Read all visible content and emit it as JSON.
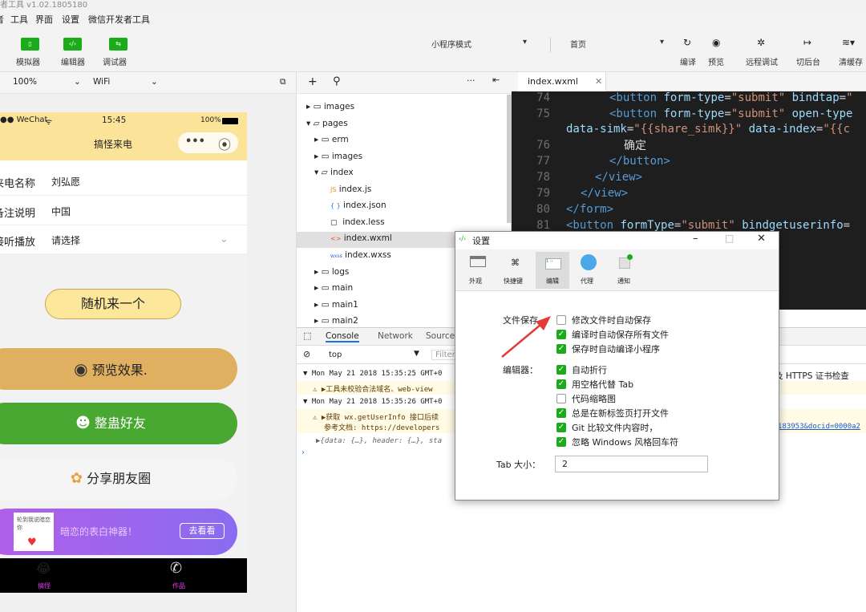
{
  "window": {
    "title": "者工具 v1.02.1805180"
  },
  "menu": [
    "者",
    "工具",
    "界面",
    "设置",
    "微信开发者工具"
  ],
  "toolbar": {
    "sim_label": "模拟器",
    "editor_label": "编辑器",
    "debug_label": "调试器",
    "mode": "小程序模式",
    "page": "首页",
    "compile": "编译",
    "preview": "预览",
    "remote": "远程调试",
    "background": "切后台",
    "cache": "清缓存",
    "colors": {
      "accent": "#1aad19"
    }
  },
  "simbar": {
    "zoom": "100%",
    "network": "WiFi"
  },
  "phone": {
    "carrier": "●● WeChat",
    "time": "15:45",
    "battery": "100%",
    "nav_title": "搞怪来电",
    "rows": [
      {
        "label": "来电名称",
        "value": "刘弘愿"
      },
      {
        "label": "备注说明",
        "value": "中国"
      },
      {
        "label": "接听播放",
        "value": "请选择"
      }
    ],
    "random_button": "随机来一个",
    "preview_button": "预览效果.",
    "prank_button": "整蛊好友",
    "share_button": "分享朋友圈",
    "banner_text": "暗恋的表白神器！",
    "banner_button": "去看看",
    "banner_img_text": "轮到我说暗恋你",
    "tab1": "搞怪",
    "tab2": "作品"
  },
  "filetree": {
    "items": [
      "images",
      "pages",
      "erm",
      "images",
      "index",
      "index.js",
      "index.json",
      "index.less",
      "index.wxml",
      "index.wxss",
      "logs",
      "main",
      "main1",
      "main2"
    ]
  },
  "editor": {
    "tab": "index.wxml",
    "lines": [
      {
        "n": "74",
        "code": "<button form-type=\"submit\" bindtap=\""
      },
      {
        "n": "75",
        "code": "<button form-type=\"submit\" open-type"
      },
      {
        "n": "",
        "code": "data-simk=\"{{share_simk}}\" data-index=\"{{c"
      },
      {
        "n": "76",
        "code": "确定"
      },
      {
        "n": "77",
        "code": "</button>"
      },
      {
        "n": "78",
        "code": "</view>"
      },
      {
        "n": "79",
        "code": "</view>"
      },
      {
        "n": "80",
        "code": "</form>"
      },
      {
        "n": "81",
        "code": "<button formType=\"submit\" bindgetuserinfo="
      }
    ]
  },
  "console": {
    "tabs": [
      "Console",
      "Network",
      "Sources"
    ],
    "context": "top",
    "filter": "Filter",
    "lines": [
      "▼ Mon May 21 2018 15:35:25 GMT+0",
      "⚠ ▶工具未校验合法域名、web-view",
      "▼ Mon May 21 2018 15:35:26 GMT+0",
      "⚠ ▶获取 wx.getUserInfo 接口后续",
      "参考文档: https://developers",
      "▶{data: {…}, header: {…}, sta"
    ],
    "https_check": "及 HTTPS 证书检查",
    "url_tail": "183953&docid=0000a2"
  },
  "dialog": {
    "title": "设置",
    "tabs": [
      "外观",
      "快捷键",
      "编辑",
      "代理",
      "通知"
    ],
    "file_save_label": "文件保存",
    "file_save": [
      {
        "text": "修改文件时自动保存",
        "checked": false
      },
      {
        "text": "编译时自动保存所有文件",
        "checked": true
      },
      {
        "text": "保存时自动编译小程序",
        "checked": true
      }
    ],
    "editor_label": "编辑器：",
    "editor_opts": [
      {
        "text": "自动折行",
        "checked": true
      },
      {
        "text": "用空格代替 Tab",
        "checked": true
      },
      {
        "text": "代码缩略图",
        "checked": false
      },
      {
        "text": "总是在新标签页打开文件",
        "checked": true
      },
      {
        "text": "Git 比较文件内容时，",
        "checked": true
      },
      {
        "text": "忽略 Windows 风格回车符",
        "checked": true
      }
    ],
    "tab_size_label": "Tab 大小：",
    "tab_size": "2"
  }
}
